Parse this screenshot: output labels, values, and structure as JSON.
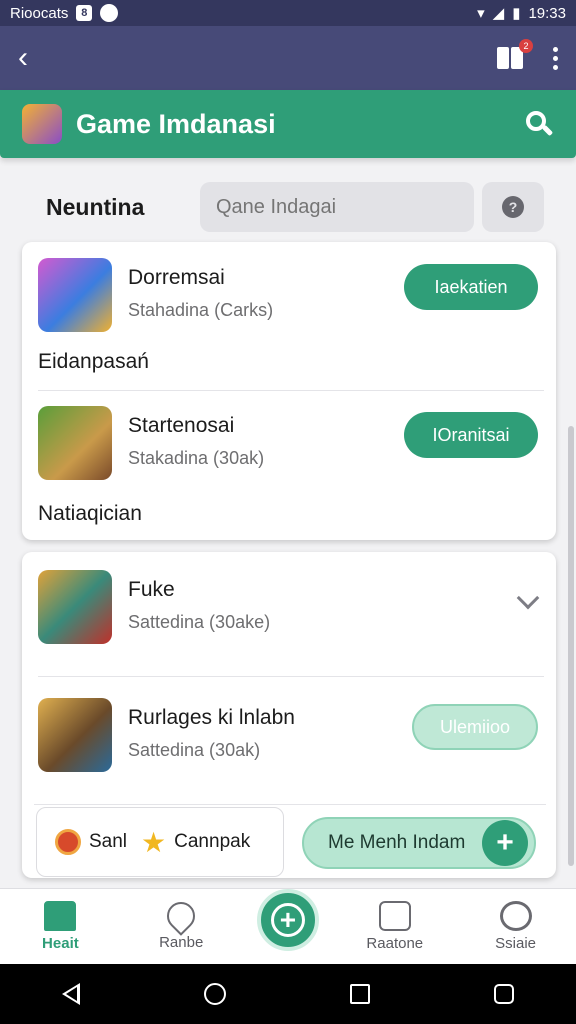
{
  "status_bar": {
    "carrier": "Rioocats",
    "badge": "8",
    "time": "19:33"
  },
  "app_bar": {
    "notification_count": "2"
  },
  "header": {
    "title": "Game Imdanasi"
  },
  "filter": {
    "label": "Neuntina",
    "search_placeholder": "Qane Indagai",
    "help": "?"
  },
  "section_one": {
    "games": [
      {
        "name": "Dorremsai",
        "subtitle": "Stahadina (Carks)",
        "action": "Iaekatien"
      },
      {
        "name": "Startenosai",
        "subtitle": "Stakadina (30ak)",
        "action": "IOranitsai"
      }
    ],
    "labels": [
      "Eidanpasań",
      "Natiaqician"
    ]
  },
  "section_two": {
    "games": [
      {
        "name": "Fuke",
        "subtitle": "Sattedina (30ake)"
      },
      {
        "name": "Rurlages ki lnlabn",
        "subtitle": "Sattedina (30ak)",
        "action": "Ulemiioo"
      }
    ],
    "chip_box": {
      "left": "Sanl",
      "right": "Cannpak"
    },
    "menu_button": "Me Menh Indam",
    "plus": "+"
  },
  "bottom_nav": [
    {
      "label": "Heait"
    },
    {
      "label": "Ranbe"
    },
    {
      "label": "Raatone"
    },
    {
      "label": "Ssiaie"
    }
  ],
  "colors": {
    "primary": "#2f9e78",
    "app_bar": "#474a78",
    "status_bar": "#34375e"
  }
}
